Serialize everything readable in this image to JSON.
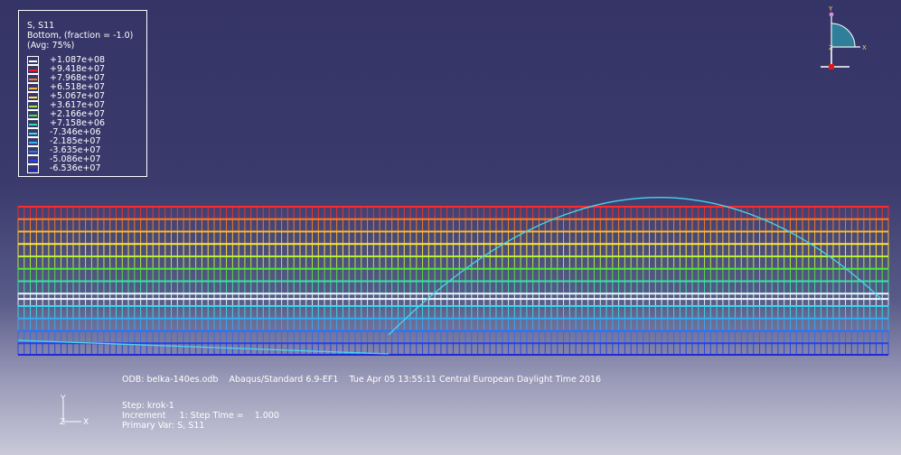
{
  "legend": {
    "title_lines": [
      "S, S11",
      "Bottom, (fraction = -1.0)",
      "(Avg: 75%)"
    ],
    "entries": [
      {
        "label": "+1.087e+08",
        "color": "#ffffff"
      },
      {
        "label": "+9.418e+07",
        "color": "#ff1a1a"
      },
      {
        "label": "+7.968e+07",
        "color": "#ff7a1e"
      },
      {
        "label": "+6.518e+07",
        "color": "#ffb830"
      },
      {
        "label": "+5.067e+07",
        "color": "#ffe83a"
      },
      {
        "label": "+3.617e+07",
        "color": "#9cef3a"
      },
      {
        "label": "+2.166e+07",
        "color": "#3fe83c"
      },
      {
        "label": "+7.158e+06",
        "color": "#2fe39a"
      },
      {
        "label": "-7.346e+06",
        "color": "#35e0e8"
      },
      {
        "label": "-2.185e+07",
        "color": "#2fb6f4"
      },
      {
        "label": "-3.635e+07",
        "color": "#2d74f7"
      },
      {
        "label": "-5.086e+07",
        "color": "#2740f2"
      },
      {
        "label": "-6.536e+07",
        "color": "#1e20dc"
      }
    ]
  },
  "mesh": {
    "bands": [
      {
        "color": "#ff2a2a",
        "value": 0.94
      },
      {
        "color": "#ff7a1e",
        "value": 0.8
      },
      {
        "color": "#ffb830",
        "value": 0.65
      },
      {
        "color": "#ffe83a",
        "value": 0.51
      },
      {
        "color": "#b8ef3a",
        "value": 0.37
      },
      {
        "color": "#4fe83c",
        "value": 0.23
      },
      {
        "color": "#39e4a6",
        "value": 0.1
      },
      {
        "color": "#e6f7ff",
        "value": 0.02
      },
      {
        "color": "#38d8ec",
        "value": -0.12
      },
      {
        "color": "#31aef4",
        "value": -0.26
      },
      {
        "color": "#2d6ef6",
        "value": -0.4
      },
      {
        "color": "#2440f0",
        "value": -0.55
      }
    ],
    "element_count": 142,
    "curve_color": "#46d6f0"
  },
  "info": {
    "odb_line": "ODB: belka-140es.odb    Abaqus/Standard 6.9-EF1    Tue Apr 05 13:55:11 Central European Daylight Time 2016",
    "step_line": "Step: krok-1",
    "increment_line": "Increment     1: Step Time =    1.000",
    "primary_var_line": "Primary Var: S, S11"
  },
  "triad": {
    "y_label": "Y",
    "x_label": "X",
    "z_label": "Z"
  },
  "view_triad": {
    "y_label": "Y",
    "x_label": "X",
    "z_label": "Z"
  }
}
